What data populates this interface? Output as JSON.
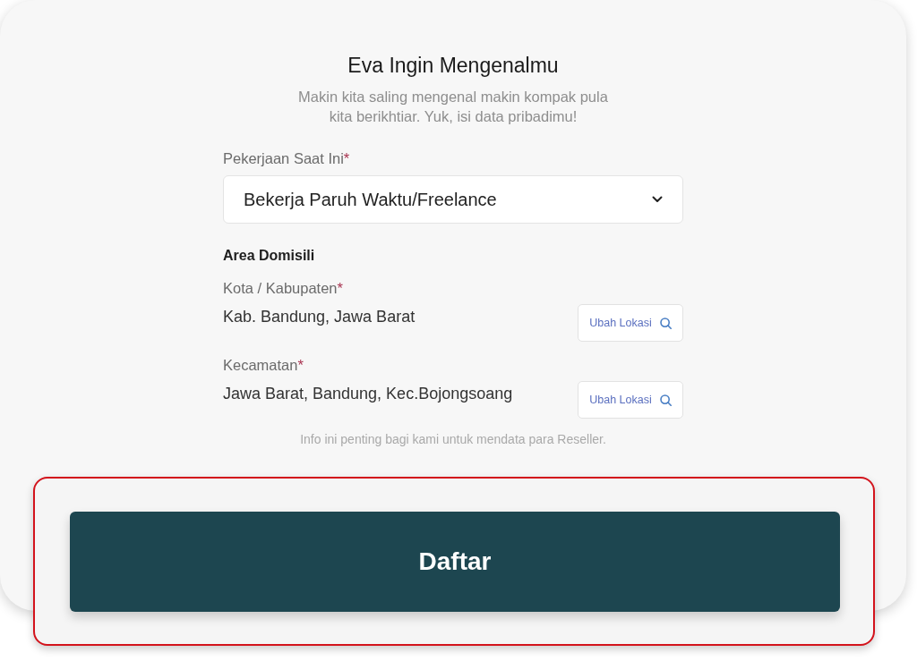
{
  "form": {
    "title": "Eva Ingin Mengenalmu",
    "subtitle": "Makin kita saling mengenal makin kompak pula\nkita berikhtiar. Yuk, isi data pribadimu!",
    "occupation": {
      "label": "Pekerjaan Saat Ini",
      "required_mark": "*",
      "value": "Bekerja Paruh Waktu/Freelance"
    },
    "area": {
      "heading": "Area Domisili",
      "fields": [
        {
          "label": "Kota / Kabupaten",
          "required_mark": "*",
          "value": "Kab. Bandung, Jawa Barat",
          "button": "Ubah Lokasi"
        },
        {
          "label": "Kecamatan",
          "required_mark": "*",
          "value": "Jawa Barat, Bandung, Kec.Bojongsoang",
          "button": "Ubah Lokasi"
        }
      ]
    },
    "note": "Info ini penting bagi kami untuk mendata para Reseller."
  },
  "submit": {
    "label": "Daftar",
    "highlighted": true
  }
}
